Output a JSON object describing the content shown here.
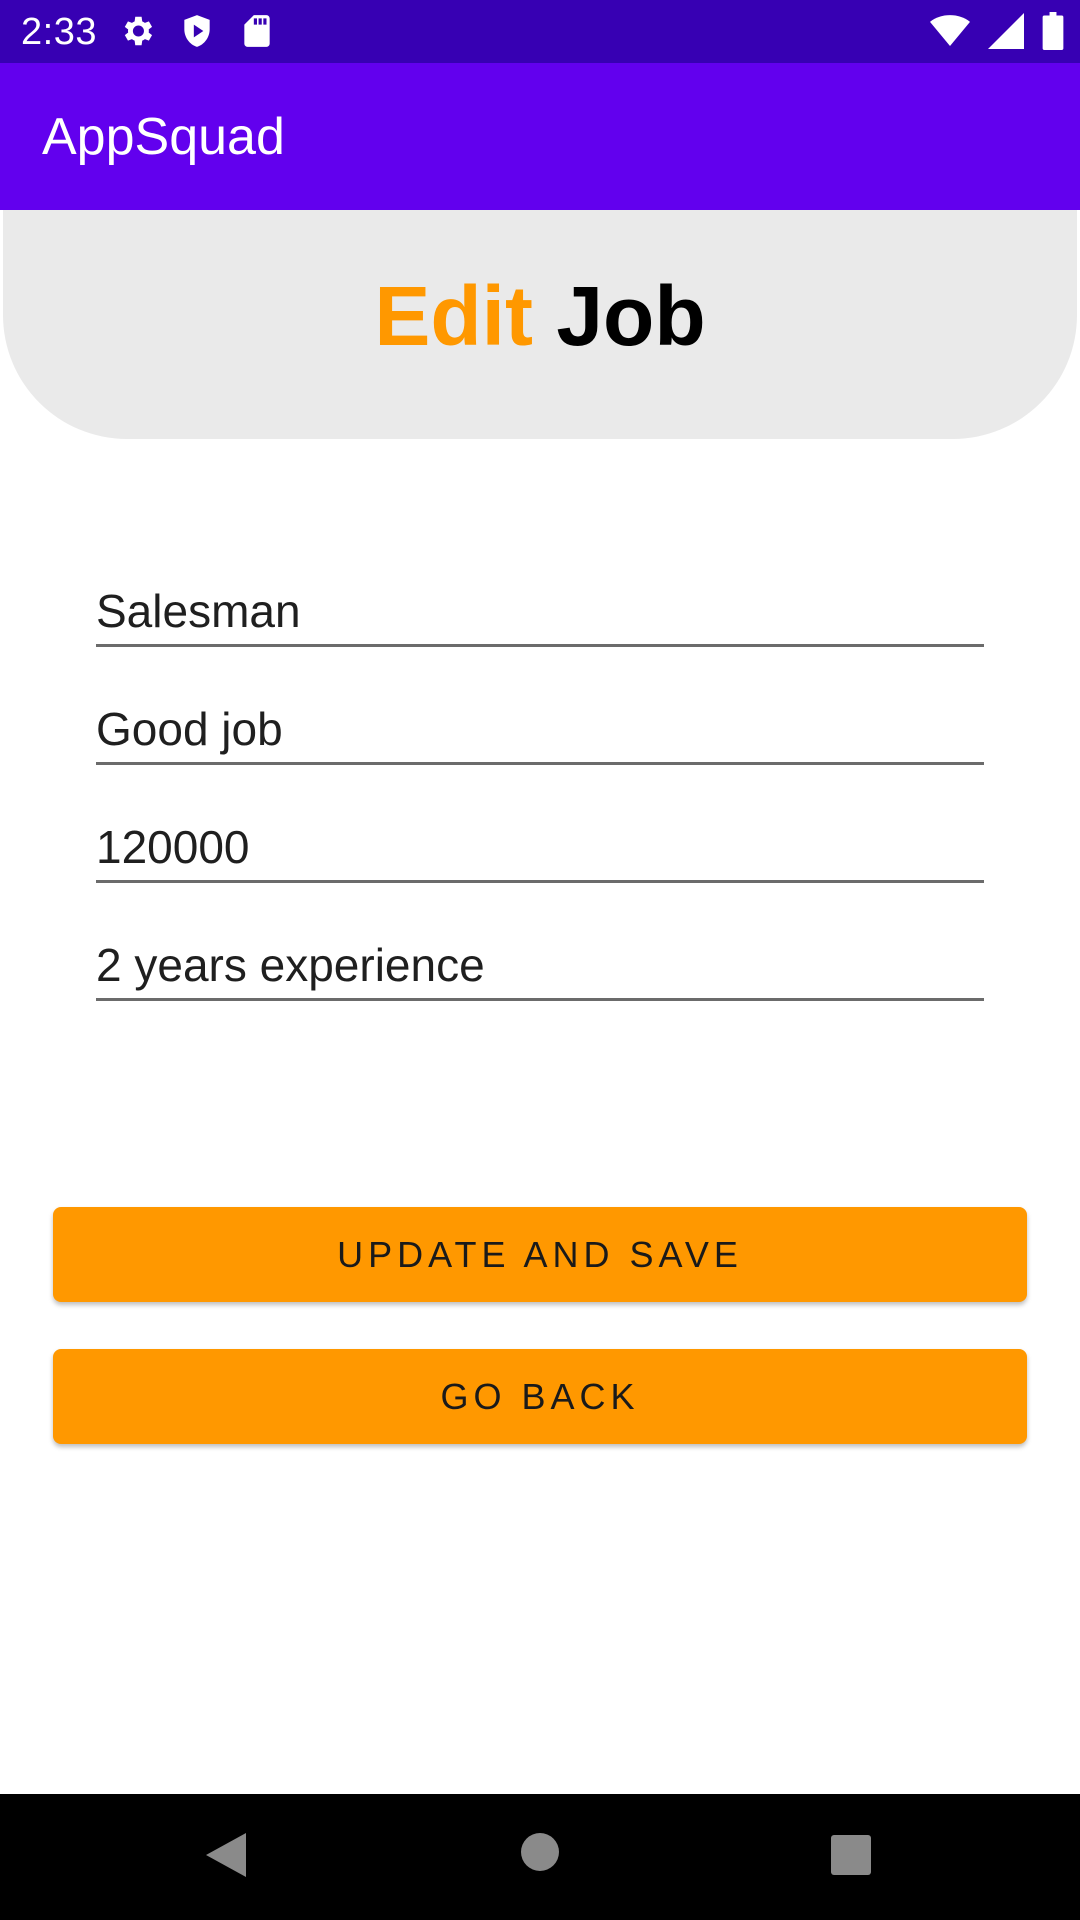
{
  "status_bar": {
    "time": "2:33",
    "left_icons": [
      "gear-icon",
      "shield-play-icon",
      "sd-card-icon"
    ],
    "right_icons": [
      "wifi-icon",
      "cell-signal-icon",
      "battery-icon"
    ],
    "background": "#3700B3"
  },
  "app_bar": {
    "title": "AppSquad",
    "background": "#6200EE"
  },
  "header": {
    "title_accent": "Edit",
    "title_rest": "Job",
    "accent_color": "#FF9800",
    "background": "#EAEAEA"
  },
  "form": {
    "fields": [
      {
        "name": "job-title",
        "value": "Salesman"
      },
      {
        "name": "job-description",
        "value": "Good job"
      },
      {
        "name": "salary",
        "value": "120000"
      },
      {
        "name": "requirements",
        "value": "2 years experience"
      }
    ]
  },
  "actions": {
    "update_label": "UPDATE AND SAVE",
    "back_label": "GO BACK",
    "button_color": "#FF9800"
  },
  "nav_bar": {
    "buttons": [
      "back-triangle-icon",
      "home-circle-icon",
      "recents-square-icon"
    ]
  }
}
